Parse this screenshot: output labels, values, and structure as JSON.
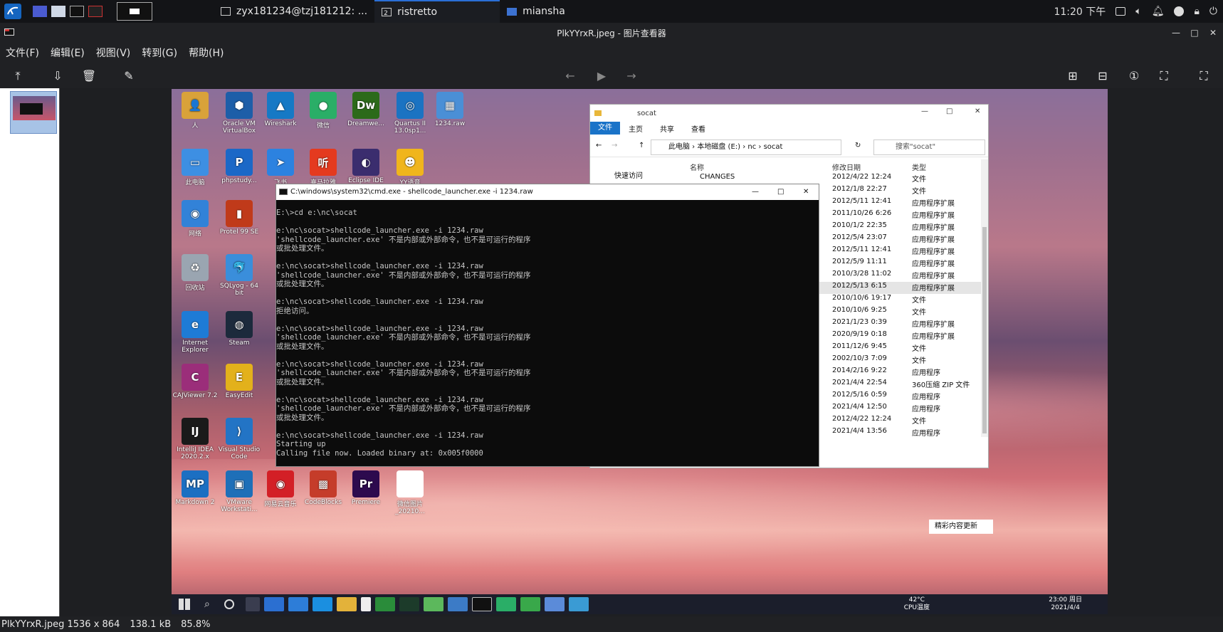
{
  "topbar": {
    "tasks": [
      {
        "label": "zyx181234@tzj181212: ..."
      },
      {
        "label": "ristretto",
        "badge": "2"
      },
      {
        "label": "miansha"
      }
    ],
    "clock": "11:20 下午"
  },
  "viewer": {
    "title": "PlkYYrxR.jpeg - 图片查看器",
    "menus": [
      "文件(F)",
      "编辑(E)",
      "视图(V)",
      "转到(G)",
      "帮助(H)"
    ],
    "status": {
      "filename": "PlkYYrxR.jpeg 1536 x 864",
      "size": "138.1 kB",
      "zoom": "85.8%"
    }
  },
  "desktop": {
    "icons": [
      {
        "label": "人",
        "glyph": "👤",
        "color": "#d9a23a"
      },
      {
        "label": "Oracle VM VirtualBox",
        "glyph": "⬢",
        "color": "#1d5ea8"
      },
      {
        "label": "Wireshark",
        "glyph": "▲",
        "color": "#1679c5"
      },
      {
        "label": "微信",
        "glyph": "●",
        "color": "#2aae67"
      },
      {
        "label": "Dreamwe...",
        "glyph": "Dw",
        "color": "#2c6a1a"
      },
      {
        "label": "Quartus II 13.0sp1...",
        "glyph": "◎",
        "color": "#1b73c2"
      },
      {
        "label": "1234.raw",
        "glyph": "▦",
        "color": "#4a8fd6"
      },
      {
        "label": "此电脑",
        "glyph": "▭",
        "color": "#3d8fe3"
      },
      {
        "label": "phpstudy...",
        "glyph": "P",
        "color": "#1b68c7"
      },
      {
        "label": "飞书",
        "glyph": "➤",
        "color": "#2c82e0"
      },
      {
        "label": "喜马拉雅",
        "glyph": "听",
        "color": "#e43a1f"
      },
      {
        "label": "Eclipse IDE",
        "glyph": "◐",
        "color": "#3b2d6e"
      },
      {
        "label": "YY语音",
        "glyph": "☻",
        "color": "#f0b51c"
      },
      {
        "label": "网络",
        "glyph": "◉",
        "color": "#3282d8"
      },
      {
        "label": "Protel 99 SE",
        "glyph": "▮",
        "color": "#c03a1a"
      },
      {
        "label": "回收站",
        "glyph": "♻",
        "color": "#9aa5b1"
      },
      {
        "label": "SQLyog - 64 bit",
        "glyph": "🐬",
        "color": "#3a8edb"
      },
      {
        "label": "Internet Explorer",
        "glyph": "e",
        "color": "#1e7bd6"
      },
      {
        "label": "Steam",
        "glyph": "◍",
        "color": "#1c2a3c"
      },
      {
        "label": "CAJViewer 7.2",
        "glyph": "C",
        "color": "#9b2e7a"
      },
      {
        "label": "EasyEdit",
        "glyph": "E",
        "color": "#e3b11b"
      },
      {
        "label": "IntelliJ IDEA 2020.2.x",
        "glyph": "IJ",
        "color": "#1a1a1a"
      },
      {
        "label": "Visual Studio Code",
        "glyph": "⟩",
        "color": "#2374c5"
      },
      {
        "label": "Markdown 2",
        "glyph": "MP",
        "color": "#1c6fc2"
      },
      {
        "label": "VMware Workstati...",
        "glyph": "▣",
        "color": "#1e6fb8"
      },
      {
        "label": "网易云音乐",
        "glyph": "◉",
        "color": "#d31f26"
      },
      {
        "label": "CodeBlocks",
        "glyph": "▩",
        "color": "#c53c2a"
      },
      {
        "label": "Premiere",
        "glyph": "Pr",
        "color": "#2d0a4e"
      },
      {
        "label": "微信图片_20210...",
        "glyph": "",
        "color": "#ffffff"
      }
    ]
  },
  "explorer": {
    "title": "socat",
    "ribbon": [
      "文件",
      "主页",
      "共享",
      "查看"
    ],
    "path": [
      "此电脑",
      "本地磁盘 (E:)",
      "nc",
      "socat"
    ],
    "search_placeholder": "搜索\"socat\"",
    "quick_access": "快速访问",
    "columns": {
      "name": "名称",
      "date": "修改日期",
      "type": "类型"
    },
    "rows": [
      {
        "name": "CHANGES",
        "date": "2012/4/22 12:24",
        "type": "文件"
      },
      {
        "name": "",
        "date": "2012/1/8 22:27",
        "type": "文件"
      },
      {
        "name": "",
        "date": "2012/5/11 12:41",
        "type": "应用程序扩展"
      },
      {
        "name": "",
        "date": "2011/10/26 6:26",
        "type": "应用程序扩展"
      },
      {
        "name": "",
        "date": "2010/1/2 22:35",
        "type": "应用程序扩展"
      },
      {
        "name": "",
        "date": "2012/5/4 23:07",
        "type": "应用程序扩展"
      },
      {
        "name": "",
        "date": "2012/5/11 12:41",
        "type": "应用程序扩展"
      },
      {
        "name": "",
        "date": "2012/5/9 11:11",
        "type": "应用程序扩展"
      },
      {
        "name": "",
        "date": "2010/3/28 11:02",
        "type": "应用程序扩展"
      },
      {
        "name": "",
        "date": "2012/5/13 6:15",
        "type": "应用程序扩展"
      },
      {
        "name": "",
        "date": "2010/10/6 19:17",
        "type": "文件"
      },
      {
        "name": "",
        "date": "2010/10/6 9:25",
        "type": "文件"
      },
      {
        "name": "",
        "date": "2021/1/23 0:39",
        "type": "应用程序扩展"
      },
      {
        "name": "",
        "date": "2020/9/19 0:18",
        "type": "应用程序扩展"
      },
      {
        "name": "",
        "date": "2011/12/6 9:45",
        "type": "文件"
      },
      {
        "name": "",
        "date": "2002/10/3 7:09",
        "type": "文件"
      },
      {
        "name": "",
        "date": "2014/2/16 9:22",
        "type": "应用程序"
      },
      {
        "name": "",
        "date": "2021/4/4 22:54",
        "type": "360压缩 ZIP 文件"
      },
      {
        "name": "",
        "date": "2012/5/16 0:59",
        "type": "应用程序"
      },
      {
        "name": "",
        "date": "2021/4/4 12:50",
        "type": "应用程序"
      },
      {
        "name": "",
        "date": "2012/4/22 12:24",
        "type": "文件"
      },
      {
        "name": "",
        "date": "2021/4/4 13:56",
        "type": "应用程序"
      }
    ]
  },
  "cmd": {
    "title": "C:\\windows\\system32\\cmd.exe - shellcode_launcher.exe  -i 1234.raw",
    "lines": [
      "E:\\>cd e:\\nc\\socat",
      "",
      "e:\\nc\\socat>shellcode_launcher.exe -i 1234.raw",
      "'shellcode_launcher.exe' 不是内部或外部命令，也不是可运行的程序",
      "或批处理文件。",
      "",
      "e:\\nc\\socat>shellcode_launcher.exe -i 1234.raw",
      "'shellcode_launcher.exe' 不是内部或外部命令，也不是可运行的程序",
      "或批处理文件。",
      "",
      "e:\\nc\\socat>shellcode_launcher.exe -i 1234.raw",
      "拒绝访问。",
      "",
      "e:\\nc\\socat>shellcode_launcher.exe -i 1234.raw",
      "'shellcode_launcher.exe' 不是内部或外部命令，也不是可运行的程序",
      "或批处理文件。",
      "",
      "e:\\nc\\socat>shellcode_launcher.exe -i 1234.raw",
      "'shellcode_launcher.exe' 不是内部或外部命令，也不是可运行的程序",
      "或批处理文件。",
      "",
      "e:\\nc\\socat>shellcode_launcher.exe -i 1234.raw",
      "'shellcode_launcher.exe' 不是内部或外部命令，也不是可运行的程序",
      "或批处理文件。",
      "",
      "e:\\nc\\socat>shellcode_launcher.exe -i 1234.raw",
      "Starting up",
      "Calling file now. Loaded binary at: 0x005f0000"
    ]
  },
  "wintaskbar": {
    "temp": "42°C",
    "temp_label": "CPU温度",
    "time": "23:00 周日",
    "date": "2021/4/4",
    "toast": "精彩内容更新"
  }
}
